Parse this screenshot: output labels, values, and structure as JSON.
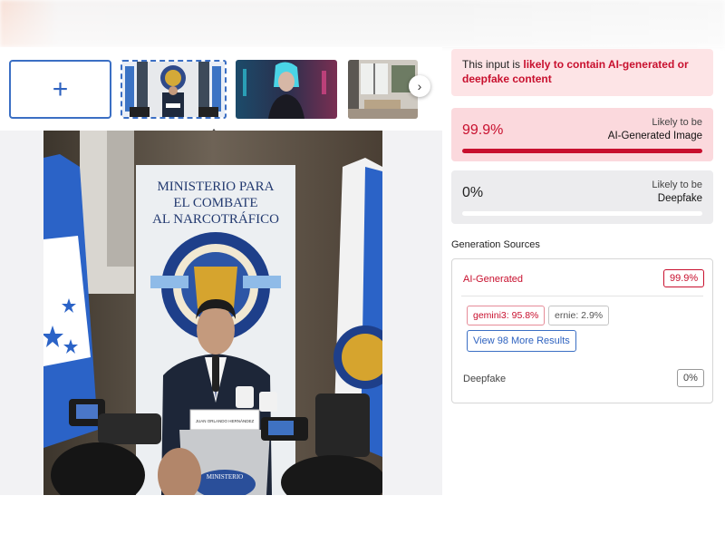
{
  "thumbnails": {
    "add_label": "+",
    "next_label": "›",
    "collapse_label": "^"
  },
  "photo": {
    "backdrop_line1": "MINISTERIO PARA",
    "backdrop_line2": "EL COMBATE",
    "backdrop_line3": "AL NARCOTRÁFICO",
    "nameplate": "JUAN ORLANDO HERNÁNDEZ",
    "podium_label": "MINISTERIO"
  },
  "alert": {
    "prefix": "This input is ",
    "highlight": "likely to contain AI-generated or deepfake content"
  },
  "ai_card": {
    "value": "99.9%",
    "fraction": 0.999,
    "label_top": "Likely to be",
    "label_bottom": "AI-Generated Image"
  },
  "deepfake_card": {
    "value": "0%",
    "fraction": 0,
    "label_top": "Likely to be",
    "label_bottom": "Deepfake"
  },
  "sources": {
    "title": "Generation Sources",
    "ai_label": "AI-Generated",
    "ai_value": "99.9%",
    "chips": [
      "gemini3: 95.8%",
      "ernie: 2.9%"
    ],
    "more_button": "View 98 More Results",
    "deepfake_label": "Deepfake",
    "deepfake_value": "0%"
  },
  "colors": {
    "accent_red": "#c8102e",
    "accent_blue": "#3b6fc4"
  }
}
